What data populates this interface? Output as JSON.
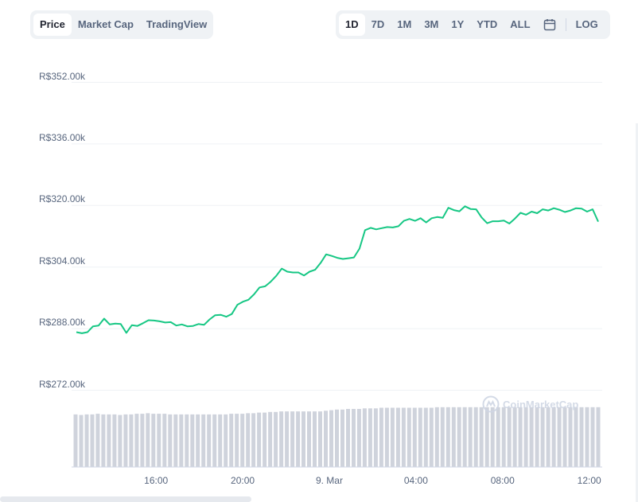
{
  "tabs_left": [
    {
      "label": "Price",
      "active": true
    },
    {
      "label": "Market Cap",
      "active": false
    },
    {
      "label": "TradingView",
      "active": false
    }
  ],
  "tabs_right": [
    {
      "label": "1D",
      "active": true
    },
    {
      "label": "7D",
      "active": false
    },
    {
      "label": "1M",
      "active": false
    },
    {
      "label": "3M",
      "active": false
    },
    {
      "label": "1Y",
      "active": false
    },
    {
      "label": "YTD",
      "active": false
    },
    {
      "label": "ALL",
      "active": false
    }
  ],
  "calendar_icon": "calendar-icon",
  "log_label": "LOG",
  "watermark": "CoinMarketCap",
  "colors": {
    "line": "#16c784",
    "volume": "#cfd3dc",
    "grid": "#eff2f5"
  },
  "chart_data": {
    "type": "line",
    "y_ticks": [
      {
        "value": 352000,
        "label": "R$352.00k"
      },
      {
        "value": 336000,
        "label": "R$336.00k"
      },
      {
        "value": 320000,
        "label": "R$320.00k"
      },
      {
        "value": 304000,
        "label": "R$304.00k"
      },
      {
        "value": 288000,
        "label": "R$288.00k"
      },
      {
        "value": 272000,
        "label": "R$272.00k"
      }
    ],
    "x_ticks": [
      {
        "label": "16:00",
        "hour": 16
      },
      {
        "label": "20:00",
        "hour": 20
      },
      {
        "label": "9. Mar",
        "hour": 24
      },
      {
        "label": "04:00",
        "hour": 28
      },
      {
        "label": "08:00",
        "hour": 32
      },
      {
        "label": "12:00",
        "hour": 36
      }
    ],
    "x_range_hours": [
      12.1,
      36.6
    ],
    "ylim": [
      272000,
      352000
    ],
    "grid": true,
    "series": [
      {
        "values": [
          287.1,
          286.8,
          287.1,
          288.6,
          288.8,
          290.6,
          289.1,
          289.3,
          289.2,
          286.9,
          288.9,
          288.7,
          289.4,
          290.2,
          290.1,
          289.9,
          289.6,
          289.7,
          288.8,
          289.1,
          288.6,
          288.7,
          289.2,
          289.0,
          290.4,
          291.5,
          291.6,
          291.1,
          291.8,
          294.2,
          295.0,
          295.5,
          296.9,
          298.7,
          299.0,
          300.2,
          301.7,
          303.6,
          302.8,
          302.6,
          302.6,
          301.8,
          302.8,
          303.3,
          305.1,
          307.3,
          306.9,
          306.4,
          306.1,
          306.3,
          306.5,
          308.8,
          313.6,
          314.2,
          313.8,
          314.1,
          314.4,
          314.3,
          314.6,
          316.0,
          316.5,
          316.0,
          316.7,
          315.6,
          316.7,
          317.0,
          316.8,
          319.4,
          318.8,
          318.5,
          319.8,
          319.1,
          319.0,
          316.9,
          315.4,
          315.9,
          315.9,
          316.1,
          315.3,
          316.6,
          318.1,
          317.6,
          318.4,
          318.0,
          319.0,
          318.7,
          319.3,
          318.9,
          318.3,
          318.7,
          319.3,
          319.2,
          318.4,
          319.0,
          315.8
        ],
        "unit": "thousand BRL"
      }
    ],
    "volume_relative": [
      0.87,
      0.86,
      0.87,
      0.87,
      0.88,
      0.87,
      0.87,
      0.87,
      0.86,
      0.87,
      0.87,
      0.88,
      0.88,
      0.89,
      0.88,
      0.88,
      0.88,
      0.87,
      0.87,
      0.87,
      0.87,
      0.87,
      0.87,
      0.87,
      0.87,
      0.87,
      0.87,
      0.87,
      0.88,
      0.88,
      0.88,
      0.89,
      0.89,
      0.9,
      0.9,
      0.91,
      0.91,
      0.92,
      0.92,
      0.92,
      0.92,
      0.92,
      0.92,
      0.92,
      0.92,
      0.93,
      0.94,
      0.95,
      0.95,
      0.96,
      0.96,
      0.96,
      0.97,
      0.97,
      0.97,
      0.98,
      0.98,
      0.98,
      0.98,
      0.98,
      0.98,
      0.98,
      0.98,
      0.98,
      0.98,
      0.99,
      0.99,
      0.99,
      0.99,
      0.99,
      0.99,
      0.99,
      0.99,
      0.99,
      0.99,
      0.99,
      0.99,
      0.99,
      0.99,
      0.99,
      0.99,
      0.99,
      0.99,
      0.99,
      0.99,
      0.99,
      0.99,
      0.99,
      0.99,
      0.99,
      0.99,
      0.99,
      0.99,
      0.99,
      0.99
    ]
  }
}
